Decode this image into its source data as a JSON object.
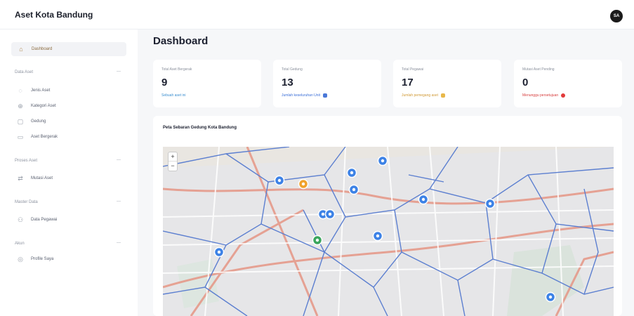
{
  "header": {
    "app_title": "Aset Kota Bandung",
    "avatar_initials": "SA"
  },
  "sidebar": {
    "active": {
      "label": "Dashboard",
      "icon": "home-icon"
    },
    "groups": [
      {
        "label": "Data Aset",
        "items": [
          {
            "label": "Jenis Aset",
            "icon": "tag-icon"
          },
          {
            "label": "Kategori Aset",
            "icon": "category-icon"
          },
          {
            "label": "Gedung",
            "icon": "building-icon"
          },
          {
            "label": "Aset Bergerak",
            "icon": "box-icon"
          }
        ]
      },
      {
        "label": "Proses Aset",
        "items": [
          {
            "label": "Mutasi Aset",
            "icon": "transfer-icon"
          }
        ]
      },
      {
        "label": "Master Data",
        "items": [
          {
            "label": "Data Pegawai",
            "icon": "user-icon"
          }
        ]
      },
      {
        "label": "Akun",
        "items": [
          {
            "label": "Profile Saya",
            "icon": "profile-icon"
          }
        ]
      }
    ]
  },
  "main": {
    "title": "Dashboard",
    "cards": [
      {
        "label": "Total Aset Bergerak",
        "value": "9",
        "note": "Sebuah aset ini",
        "note_color": "#3b8fd0",
        "dot": ""
      },
      {
        "label": "Total Gedung",
        "value": "13",
        "note": "Jumlah keseluruhan Unit",
        "note_color": "#3b6fd8",
        "dot": "#4a78d8"
      },
      {
        "label": "Total Pegawai",
        "value": "17",
        "note": "Jumlah pemegang aset",
        "note_color": "#d19a36",
        "dot": "#e8b84a"
      },
      {
        "label": "Mutasi Aset Pending",
        "value": "0",
        "note": "Menunggu persetujuan",
        "note_color": "#d84040",
        "dot": "#e23b3b"
      }
    ],
    "map": {
      "title": "Peta Sebaran Gedung Kota Bandung",
      "zoom_in": "+",
      "zoom_out": "−"
    }
  },
  "colors": {
    "marker": "#3d82e6",
    "marker_warning": "#f0a22c",
    "marker_success": "#3aa55c",
    "district_lines": "#5c7fd0",
    "map_bg": "#e9e6e1"
  }
}
